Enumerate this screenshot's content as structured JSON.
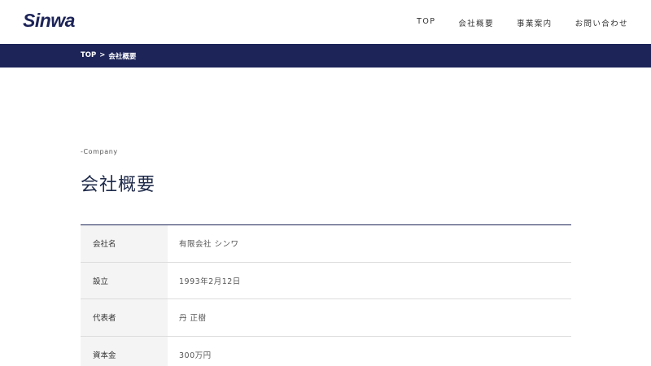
{
  "header": {
    "logo": "Sinwa",
    "nav": [
      "TOP",
      "会社概要",
      "事業案内",
      "お問い合わせ"
    ]
  },
  "breadcrumb": {
    "home": "TOP",
    "separator": ">",
    "current": "会社概要"
  },
  "main": {
    "eyebrow": "-Company",
    "title": "会社概要",
    "table": [
      {
        "label": "会社名",
        "value": "有限会社 シンワ"
      },
      {
        "label": "設立",
        "value": "1993年2月12日"
      },
      {
        "label": "代表者",
        "value": "丹 正樹"
      },
      {
        "label": "資本金",
        "value": "300万円"
      }
    ]
  },
  "colors": {
    "brand_navy": "#1c2458",
    "label_bg": "#f4f4f4",
    "row_border": "#dcdcdc"
  }
}
